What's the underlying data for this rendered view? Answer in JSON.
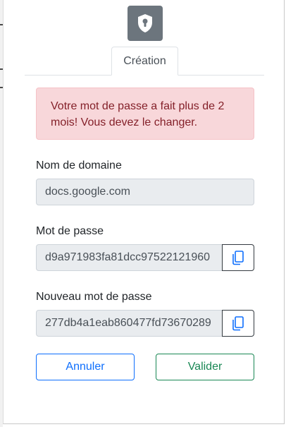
{
  "tabs": [
    {
      "label": "Création"
    }
  ],
  "alert": {
    "message": "Votre mot de passe a fait plus de 2 mois! Vous devez le changer."
  },
  "form": {
    "domain": {
      "label": "Nom de domaine",
      "value": "docs.google.com"
    },
    "password": {
      "label": "Mot de passe",
      "value": "d9a971983fa81dcc97522121960"
    },
    "new_password": {
      "label": "Nouveau mot de passe",
      "value": "277db4a1eab860477fd73670289"
    }
  },
  "buttons": {
    "cancel": "Annuler",
    "submit": "Valider"
  },
  "colors": {
    "logo_bg": "#6c757d",
    "alert_bg": "#f8d7da",
    "alert_text": "#842029",
    "primary": "#0d6efd",
    "success": "#198754"
  },
  "icons": {
    "logo": "shield-keyhole-icon",
    "copy": "copy-icon"
  }
}
